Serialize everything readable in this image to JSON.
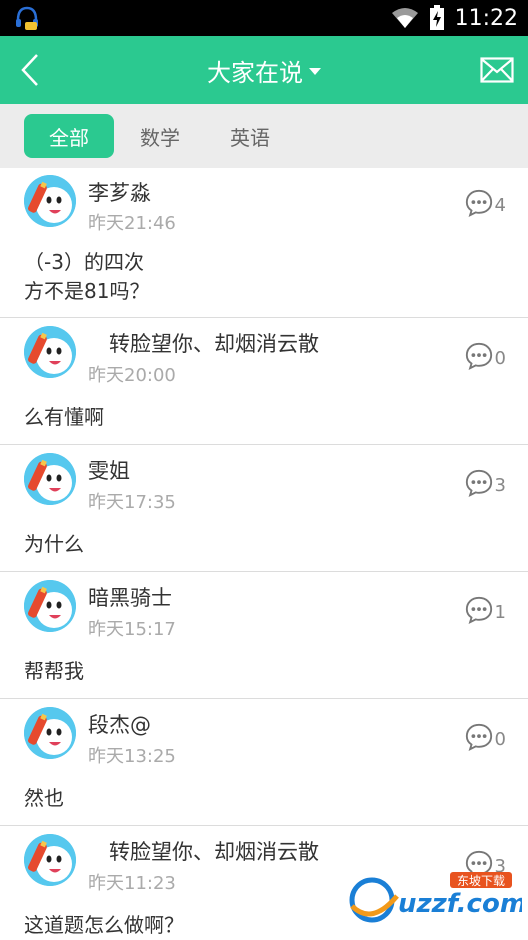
{
  "status_bar": {
    "time": "11:22"
  },
  "app_bar": {
    "title": "大家在说",
    "back_icon": "chevron-left-icon",
    "mail_icon": "mail-icon"
  },
  "tabs": [
    {
      "label": "全部",
      "active": true
    },
    {
      "label": "数学",
      "active": false
    },
    {
      "label": "英语",
      "active": false
    }
  ],
  "posts": [
    {
      "username": "李芗淼",
      "time": "昨天21:46",
      "comments": "4",
      "content_lines": [
        "（-3）的四次",
        "方不是81吗？"
      ]
    },
    {
      "username": "　转脸望你、却烟消云散",
      "time": "昨天20:00",
      "comments": "0",
      "content_lines": [
        "么有懂啊"
      ]
    },
    {
      "username": "雯姐",
      "time": "昨天17:35",
      "comments": "3",
      "content_lines": [
        "为什么"
      ]
    },
    {
      "username": "暗黑骑士",
      "time": "昨天15:17",
      "comments": "1",
      "content_lines": [
        "帮帮我"
      ]
    },
    {
      "username": "段杰@",
      "time": "昨天13:25",
      "comments": "0",
      "content_lines": [
        "然也"
      ]
    },
    {
      "username": "　转脸望你、却烟消云散",
      "time": "昨天11:23",
      "comments": "3",
      "content_lines": [
        "这道题怎么做啊？"
      ]
    }
  ],
  "watermark": {
    "text": "uzzf.com",
    "sub": "东坡下载"
  },
  "colors": {
    "accent": "#2bc990",
    "avatar_bg": "#56c8ee"
  }
}
